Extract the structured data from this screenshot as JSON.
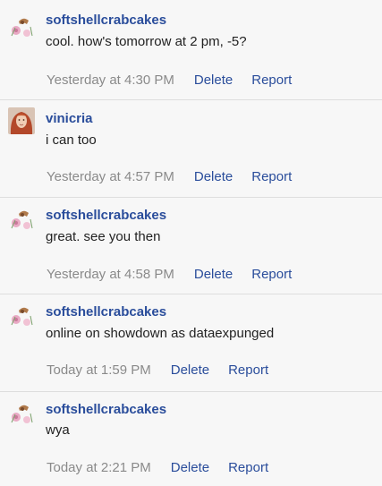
{
  "messages": [
    {
      "author": "softshellcrabcakes",
      "avatar": "crab-flower-avatar",
      "text": "cool. how's tomorrow at 2 pm, -5?",
      "time": "Yesterday at 4:30 PM",
      "delete_label": "Delete",
      "report_label": "Report"
    },
    {
      "author": "vinicria",
      "avatar": "red-hair-portrait-avatar",
      "text": "i can too",
      "time": "Yesterday at 4:57 PM",
      "delete_label": "Delete",
      "report_label": "Report"
    },
    {
      "author": "softshellcrabcakes",
      "avatar": "crab-flower-avatar",
      "text": "great. see you then",
      "time": "Yesterday at 4:58 PM",
      "delete_label": "Delete",
      "report_label": "Report"
    },
    {
      "author": "softshellcrabcakes",
      "avatar": "crab-flower-avatar",
      "text": "online on showdown as dataexpunged",
      "time": "Today at 1:59 PM",
      "delete_label": "Delete",
      "report_label": "Report"
    },
    {
      "author": "softshellcrabcakes",
      "avatar": "crab-flower-avatar",
      "text": "wya",
      "time": "Today at 2:21 PM",
      "delete_label": "Delete",
      "report_label": "Report"
    }
  ],
  "colors": {
    "link": "#2a4d9b",
    "timestamp": "#8a8a8a",
    "text": "#222222",
    "background": "#f7f7f7",
    "divider": "#dedede"
  }
}
